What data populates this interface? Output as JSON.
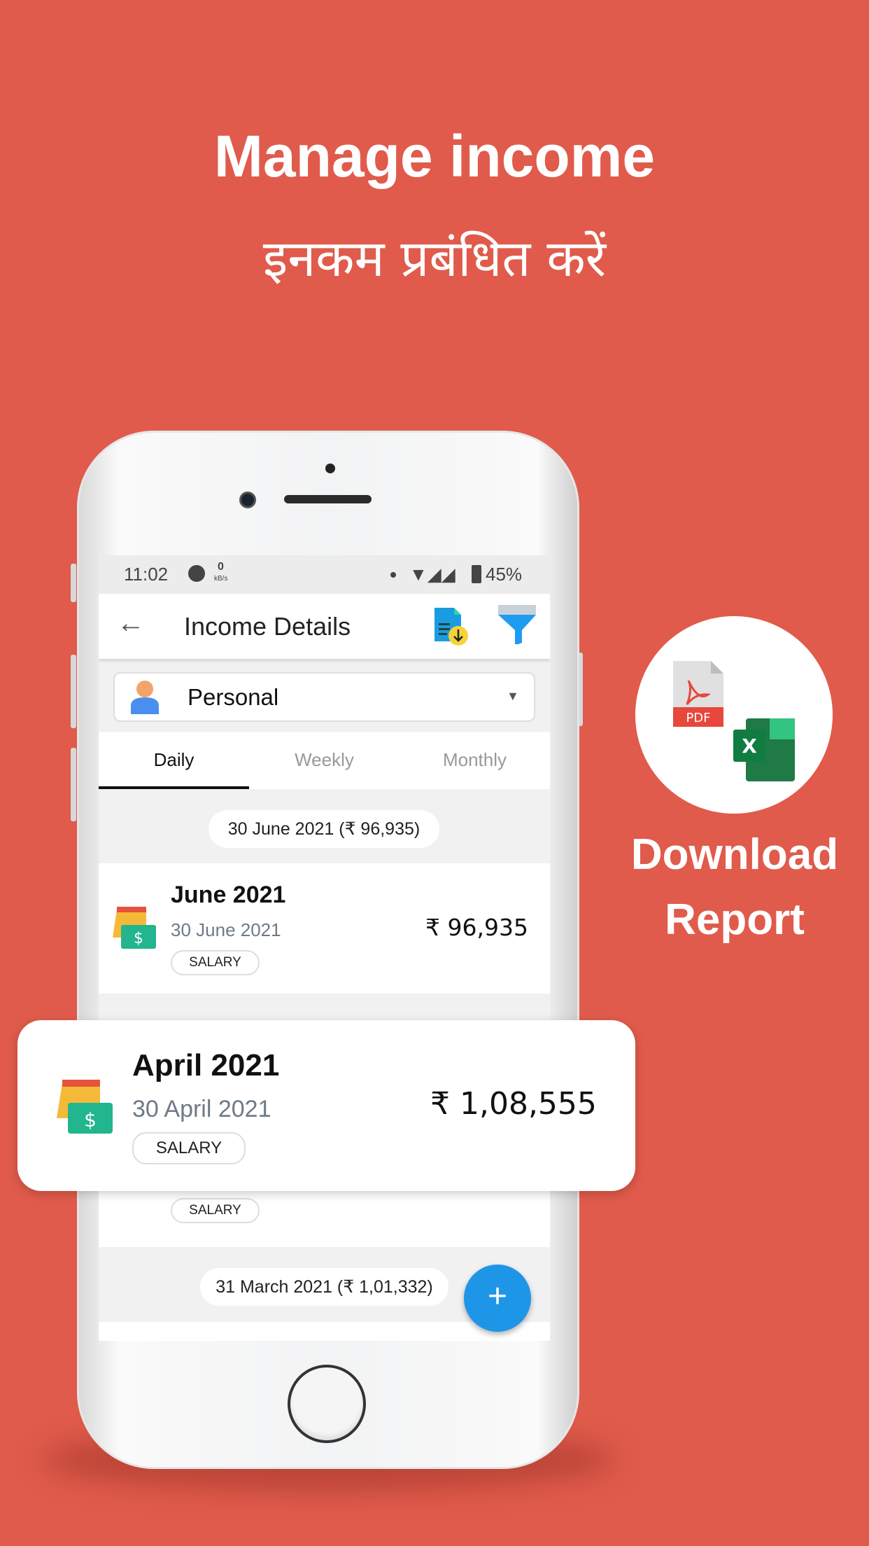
{
  "headline": "Manage income",
  "headline_hindi": "इनकम प्रबंधित करें",
  "side_promo": {
    "line1": "Download",
    "line2": "Report",
    "pdf_label": "PDF",
    "excel_label": "X"
  },
  "status_bar": {
    "time": "11:02",
    "speed_value": "0",
    "speed_unit": "kB/s",
    "battery": "45%"
  },
  "app_bar": {
    "title": "Income Details"
  },
  "account_select": {
    "value": "Personal"
  },
  "tabs": [
    {
      "label": "Daily",
      "active": true
    },
    {
      "label": "Weekly",
      "active": false
    },
    {
      "label": "Monthly",
      "active": false
    }
  ],
  "groups": [
    {
      "chip": "30 June 2021  (₹ 96,935)",
      "entry": {
        "title": "June 2021",
        "date": "30 June 2021",
        "amount": "₹ 96,935",
        "category": "SALARY"
      }
    },
    {
      "entry": {
        "category": "SALARY"
      }
    },
    {
      "chip": "31 March 2021  (₹ 1,01,332)"
    }
  ],
  "highlight_card": {
    "title": "April 2021",
    "date": "30 April 2021",
    "amount": "₹ 1,08,555",
    "category": "SALARY"
  },
  "fab": {
    "label": "+"
  },
  "colors": {
    "background": "#E05B4B",
    "fab": "#1E96E8",
    "accent_tab": "#111111"
  }
}
